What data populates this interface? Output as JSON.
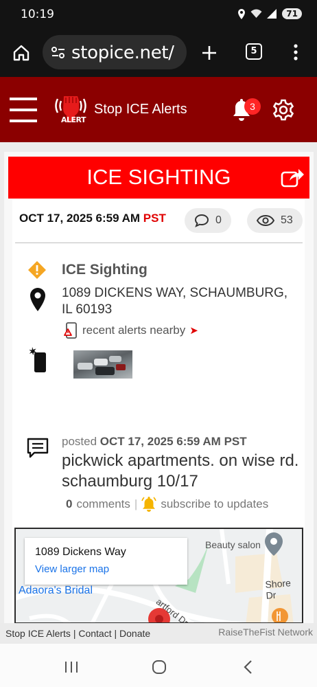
{
  "status_bar": {
    "time": "10:19",
    "battery": "71"
  },
  "browser": {
    "url": "stopice.net/",
    "tab_count": "5"
  },
  "site": {
    "title": "Stop ICE Alerts",
    "logo_badge": "ALERT",
    "notification_count": "3"
  },
  "banner": {
    "title": "ICE SIGHTING"
  },
  "report": {
    "date": "OCT 17, 2025 6:59 AM",
    "timezone": "PST",
    "comment_count": "0",
    "view_count": "53",
    "type": "ICE Sighting",
    "address_line1": "1089 DICKENS WAY, SCHAUMBURG,",
    "address_line2": "IL 60193",
    "nearby_link": "recent alerts nearby",
    "posted_prefix": "posted",
    "posted_date": "OCT 17, 2025 6:59 AM",
    "posted_tz": "PST",
    "body": "pickwick apartments. on wise rd. schaumburg 10/17",
    "comments_count": "0",
    "comments_label": "comments",
    "separator": "|",
    "subscribe_label": "subscribe to updates"
  },
  "map": {
    "place_title": "1089 Dickens Way",
    "larger_map_link": "View larger map",
    "labels": {
      "beauty_salon": "Beauty salon",
      "shore_dr": "Shore Dr",
      "adaoras_bridal": "Adaora's Bridal",
      "hartford_dr": "artford Dr"
    }
  },
  "footer": {
    "site_link": "Stop ICE Alerts",
    "contact_link": "Contact",
    "donate_link": "Donate",
    "sep": "|",
    "network": "RaiseTheFist Network"
  },
  "colors": {
    "header": "#8b0000",
    "banner": "#ff0000",
    "accent": "#e00000",
    "warning": "#f5a623",
    "link": "#1a73e8"
  },
  "icons": [
    "home-icon",
    "site-settings-icon",
    "new-tab-icon",
    "menu-dots-icon",
    "hamburger-icon",
    "fist-logo-icon",
    "bell-icon",
    "gear-icon",
    "share-icon",
    "comment-icon",
    "eye-icon",
    "warning-diamond-icon",
    "location-pin-icon",
    "phone-alert-icon",
    "phone-camera-icon",
    "message-icon",
    "bell-subscribe-icon"
  ]
}
